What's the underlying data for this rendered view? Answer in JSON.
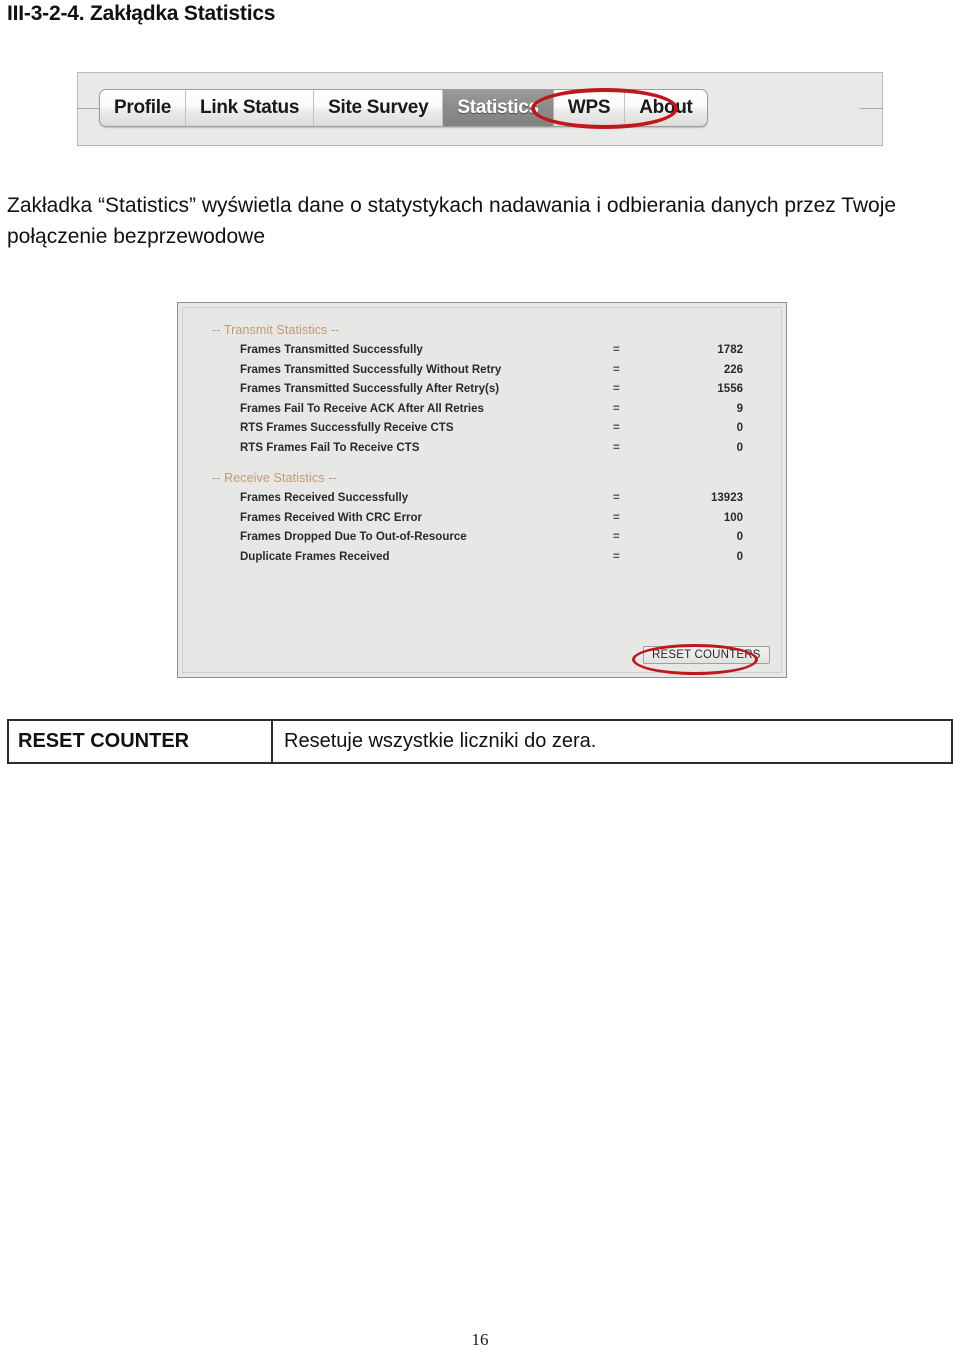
{
  "document": {
    "heading": "III-3-2-4. Zakłądka Statistics",
    "paragraph": "Zakładka “Statistics” wyświetla dane o statystykach nadawania i odbierania danych przez Twoje połączenie bezprzewodowe",
    "page_number": "16"
  },
  "screenshot_tabs": {
    "tabs": [
      {
        "label": "Profile",
        "selected": false
      },
      {
        "label": "Link Status",
        "selected": false
      },
      {
        "label": "Site Survey",
        "selected": false
      },
      {
        "label": "Statistics",
        "selected": true
      },
      {
        "label": "WPS",
        "selected": false
      },
      {
        "label": "About",
        "selected": false
      }
    ],
    "annotation_color": "#c0171c",
    "selected_tab_bg": "#8b8b89"
  },
  "statistics_panel": {
    "transmit": {
      "header": "-- Transmit Statistics --",
      "header_color": "#c09a74",
      "rows": [
        {
          "label": "Frames Transmitted Successfully",
          "eq": "=",
          "value": "1782"
        },
        {
          "label": "Frames Transmitted Successfully Without Retry",
          "eq": "=",
          "value": "226"
        },
        {
          "label": "Frames Transmitted Successfully After Retry(s)",
          "eq": "=",
          "value": "1556"
        },
        {
          "label": "Frames Fail To Receive ACK After All Retries",
          "eq": "=",
          "value": "9"
        },
        {
          "label": "RTS Frames Successfully Receive CTS",
          "eq": "=",
          "value": "0"
        },
        {
          "label": "RTS Frames Fail To Receive CTS",
          "eq": "=",
          "value": "0"
        }
      ]
    },
    "receive": {
      "header": "-- Receive Statistics --",
      "header_color": "#c09a74",
      "rows": [
        {
          "label": "Frames Received Successfully",
          "eq": "=",
          "value": "13923"
        },
        {
          "label": "Frames Received With CRC Error",
          "eq": "=",
          "value": "100"
        },
        {
          "label": "Frames Dropped Due To Out-of-Resource",
          "eq": "=",
          "value": "0"
        },
        {
          "label": "Duplicate Frames Received",
          "eq": "=",
          "value": "0"
        }
      ]
    },
    "reset_button_label": "RESET COUNTERS"
  },
  "description_table": {
    "rows": [
      {
        "key": "RESET COUNTER",
        "value": "Resetuje wszystkie liczniki do zera."
      }
    ]
  }
}
